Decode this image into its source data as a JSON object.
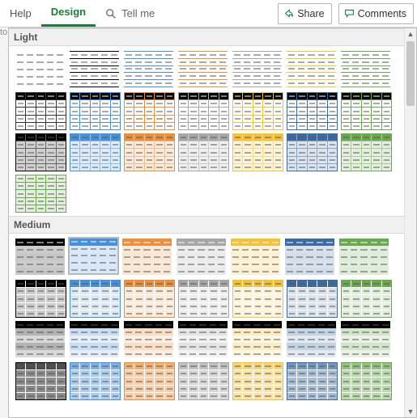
{
  "ribbon": {
    "tabs": {
      "help": "Help",
      "design": "Design"
    },
    "tell_me_label": "Tell me",
    "share_label": "Share",
    "comments_label": "Comments"
  },
  "sections": {
    "light": "Light",
    "medium": "Medium"
  },
  "accents": {
    "none": "#444444",
    "black": "#000000",
    "blue": "#4a90d9",
    "orange": "#ea8f3d",
    "gray": "#a6a6a6",
    "yellow": "#f3c13a",
    "darkblue": "#3d6aa0",
    "green": "#6aa84f"
  },
  "light_rows": [
    {
      "variant": "dash-plain",
      "colors": [
        "none",
        "black",
        "blue",
        "orange",
        "gray",
        "yellow",
        "green"
      ]
    },
    {
      "variant": "hdr-dark-boxed",
      "colors": [
        "black",
        "blue",
        "orange",
        "gray",
        "yellow",
        "darkblue",
        "green"
      ]
    },
    {
      "variant": "solid-boxed",
      "colors": [
        "black",
        "blue",
        "orange",
        "gray",
        "yellow",
        "darkblue",
        "green"
      ]
    },
    {
      "variant": "solid-green-single",
      "colors": [
        "green"
      ]
    }
  ],
  "medium_rows": [
    {
      "variant": "hdr-fill-band",
      "colors": [
        "black",
        "blue",
        "orange",
        "gray",
        "yellow",
        "darkblue",
        "green"
      ],
      "selected_index": 1
    },
    {
      "variant": "hdr-dark-band-boxed",
      "colors": [
        "black",
        "blue",
        "orange",
        "gray",
        "yellow",
        "darkblue",
        "green"
      ]
    },
    {
      "variant": "hdr-fill-dark-body",
      "colors": [
        "black",
        "blue",
        "orange",
        "gray",
        "yellow",
        "darkblue",
        "green"
      ]
    },
    {
      "variant": "all-dark-grid",
      "colors": [
        "black",
        "blue",
        "orange",
        "gray",
        "yellow",
        "darkblue",
        "green"
      ]
    }
  ]
}
